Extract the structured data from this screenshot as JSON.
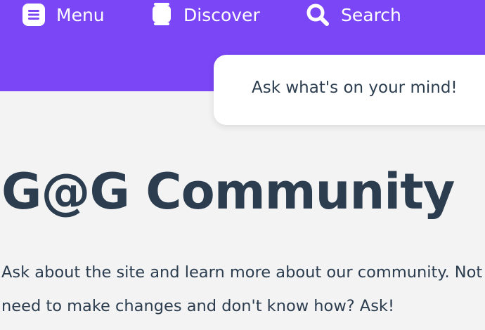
{
  "nav": {
    "menu_label": "Menu",
    "discover_label": "Discover",
    "search_label": "Search"
  },
  "icons": {
    "menu": "menu-icon",
    "discover": "discover-icon",
    "search": "search-icon"
  },
  "ask_box": {
    "placeholder": "Ask what's on your mind!"
  },
  "page": {
    "title": "G@G Community",
    "description_lines": [
      "Ask about the site and learn more about our community. Not",
      "need to make changes and don't know how? Ask!"
    ]
  },
  "colors": {
    "header_bg": "#7b46f6",
    "page_bg": "#f3f3f3",
    "text": "#2b3d4f",
    "card_bg": "#ffffff"
  }
}
